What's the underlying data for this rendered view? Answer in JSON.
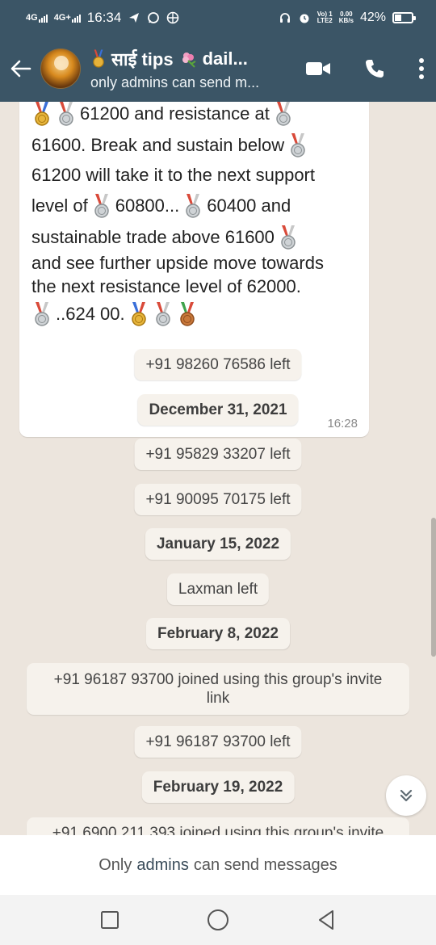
{
  "status_bar": {
    "net1": "4G",
    "net2": "4G+",
    "time": "16:34",
    "volte_top": "Vo) 1",
    "volte_bottom": "LTE2",
    "speed_top": "0.00",
    "speed_bottom": "KB/s",
    "battery_text": "42%",
    "battery_level": 0.42
  },
  "header": {
    "title": "साई tips",
    "title_suffix": "dail...",
    "subtitle": "only admins can send m..."
  },
  "message": {
    "lines": [
      "61200 and resistance at",
      "61600. Break and sustain below",
      "61200 will take it to the next support",
      "level of",
      "60800...",
      "60400 and",
      "sustainable trade above 61600",
      "and see further upside move towards",
      "the next resistance level of 62000.",
      "..624 00."
    ],
    "time": "16:28"
  },
  "events": [
    {
      "text": "+91 98260 76586 left",
      "kind": "system"
    },
    {
      "text": "December 31, 2021",
      "kind": "date"
    },
    {
      "text": "+91 95829 33207 left",
      "kind": "system"
    },
    {
      "text": "+91 90095 70175 left",
      "kind": "system"
    },
    {
      "text": "January 15, 2022",
      "kind": "date"
    },
    {
      "text": "Laxman left",
      "kind": "system"
    },
    {
      "text": "February 8, 2022",
      "kind": "date"
    },
    {
      "text": "+91 96187 93700 joined using this group's invite link",
      "kind": "system"
    },
    {
      "text": "+91 96187 93700 left",
      "kind": "system"
    },
    {
      "text": "February 19, 2022",
      "kind": "date"
    },
    {
      "text": "+91 6900 211 393 joined using this group's invite",
      "kind": "system"
    }
  ],
  "footer": {
    "notice_pre": "Only",
    "notice_kw": "admins",
    "notice_post": "can send messages"
  },
  "colors": {
    "header_bg": "#3b5566",
    "chat_bg": "#ece5dd",
    "bubble_bg": "#ffffff",
    "system_pill_bg": "#f6f2ec"
  },
  "icons": [
    "back-arrow-icon",
    "medal-icon",
    "flower-icon",
    "video-call-icon",
    "voice-call-icon",
    "more-options-icon",
    "scroll-down-icon",
    "recents-nav-icon",
    "home-nav-icon",
    "back-nav-icon"
  ]
}
